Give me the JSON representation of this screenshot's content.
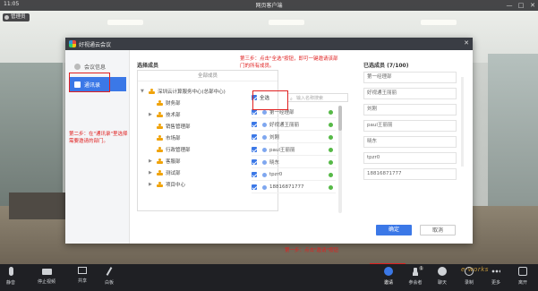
{
  "status_bar": {
    "time": "11:05",
    "title": "网页客户端",
    "controls": [
      "—",
      "□",
      "✕"
    ]
  },
  "manage_pill": "管理员",
  "dialog": {
    "title": "好视通云会议",
    "close": "✕",
    "sidebar": [
      {
        "label": "会议信息",
        "active": false
      },
      {
        "label": "通讯录",
        "active": true
      }
    ],
    "select_members_label": "选择成员",
    "tree_search": "全部成员",
    "tree": [
      {
        "label": "深圳云计算服务中心(总部中心)",
        "level": 0,
        "arrow": "▼"
      },
      {
        "label": "财务部",
        "level": 1,
        "arrow": ""
      },
      {
        "label": "技术部",
        "level": 1,
        "arrow": "▶"
      },
      {
        "label": "销售管理部",
        "level": 1,
        "arrow": ""
      },
      {
        "label": "市场部",
        "level": 1,
        "arrow": ""
      },
      {
        "label": "行政管理部",
        "level": 1,
        "arrow": ""
      },
      {
        "label": "客服部",
        "level": 1,
        "arrow": "▶"
      },
      {
        "label": "测试部",
        "level": 1,
        "arrow": "▶"
      },
      {
        "label": "项目中心",
        "level": 1,
        "arrow": "▶"
      }
    ],
    "select_all": "全选",
    "member_search_placeholder": "输入名称搜索",
    "members": [
      "第一经理部",
      "好视通王丽丽",
      "刘刚",
      "paul王丽丽",
      "晓东",
      "tpzr0",
      "18816871777"
    ],
    "selected_label": "已选成员 (7/100)",
    "selected": [
      "第一经理部",
      "好视通王丽丽",
      "刘刚",
      "paul王丽丽",
      "晓东",
      "tpzr0",
      "18816871777"
    ],
    "ok": "确定",
    "cancel": "取消"
  },
  "annotations": {
    "step1": "第一步：点击\"邀请\"按钮",
    "step2": "第二步：在\"通讯录\"里选择需要邀请的部门。",
    "step3": "第三步：点击\"全选\"按钮，即可一键邀请该部门的所有成员。"
  },
  "toolbar": [
    {
      "label": "静音",
      "icon": "microphone-icon"
    },
    {
      "label": "停止视频",
      "icon": "camera-icon"
    },
    {
      "label": "共享",
      "icon": "screen-share-icon"
    },
    {
      "label": "白板",
      "icon": "whiteboard-icon"
    },
    {
      "label": "邀请",
      "icon": "invite-icon"
    },
    {
      "label": "参会者",
      "icon": "participants-icon",
      "badge": "1"
    },
    {
      "label": "聊天",
      "icon": "chat-icon"
    },
    {
      "label": "录制",
      "icon": "record-icon"
    },
    {
      "label": "更多",
      "icon": "more-icon"
    },
    {
      "label": "离开",
      "icon": "leave-icon"
    }
  ],
  "watermark": "e-works",
  "colors": {
    "accent": "#3b78e7",
    "annotation": "#e02020",
    "toolbar_bg": "#1f2024",
    "online": "#56b947"
  }
}
